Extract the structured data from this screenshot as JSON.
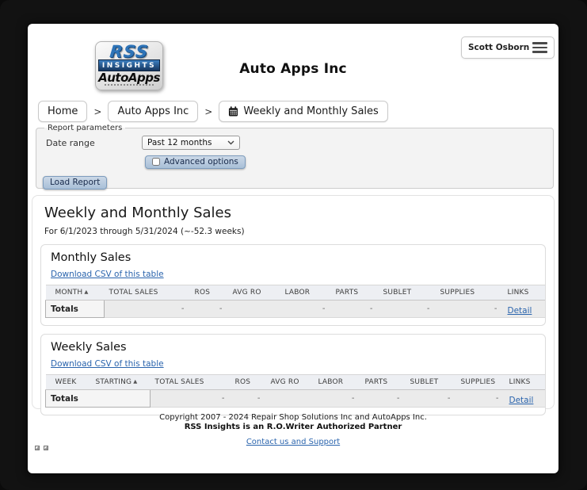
{
  "colors": {
    "page_bg": "#0b0b0b",
    "link": "#2a64ad",
    "button_bg": "#aec3da",
    "table_header_bg": "#edeff3",
    "logo_blue": "#2e74b8"
  },
  "user_menu": {
    "label": "Scott Osborn"
  },
  "header": {
    "title": "Auto Apps Inc",
    "logo": {
      "rss": "RSS",
      "insights": "INSIGHTS",
      "autoapps": "AutoApps"
    }
  },
  "breadcrumb": {
    "separator": ">",
    "items": [
      {
        "label": "Home"
      },
      {
        "label": "Auto Apps Inc"
      },
      {
        "label": "Weekly and Monthly Sales",
        "icon": "calendar-icon"
      }
    ]
  },
  "report_parameters": {
    "legend": "Report parameters",
    "date_range_label": "Date range",
    "date_range_value": "Past 12 months",
    "advanced_options_label": "Advanced options",
    "advanced_options_checked": false,
    "load_report_label": "Load Report"
  },
  "report": {
    "title": "Weekly and Monthly Sales",
    "subtitle": "For 6/1/2023 through 5/31/2024 (~-52.3 weeks)",
    "tables": [
      {
        "title": "Monthly Sales",
        "csv_link_label": "Download CSV of this table",
        "columns": [
          {
            "label": "MONTH",
            "sort": "asc"
          },
          {
            "label": "TOTAL SALES"
          },
          {
            "label": "ROS"
          },
          {
            "label": "AVG RO"
          },
          {
            "label": "LABOR"
          },
          {
            "label": "PARTS"
          },
          {
            "label": "SUBLET"
          },
          {
            "label": "SUPPLIES"
          },
          {
            "label": "LINKS"
          }
        ],
        "totals": {
          "label": "Totals",
          "label_colspan": 1,
          "values": [
            "-",
            "-",
            "",
            "-",
            "-",
            "-",
            "-"
          ],
          "detail_link_label": "Detail"
        }
      },
      {
        "title": "Weekly Sales",
        "csv_link_label": "Download CSV of this table",
        "columns": [
          {
            "label": "WEEK"
          },
          {
            "label": "STARTING",
            "sort": "asc"
          },
          {
            "label": "TOTAL SALES"
          },
          {
            "label": "ROS"
          },
          {
            "label": "AVG RO"
          },
          {
            "label": "LABOR"
          },
          {
            "label": "PARTS"
          },
          {
            "label": "SUBLET"
          },
          {
            "label": "SUPPLIES"
          },
          {
            "label": "LINKS"
          }
        ],
        "totals": {
          "label": "Totals",
          "label_colspan": 2,
          "values": [
            "-",
            "-",
            "",
            "-",
            "-",
            "-",
            "-"
          ],
          "detail_link_label": "Detail"
        }
      }
    ]
  },
  "footer": {
    "line1": "Copyright 2007 - 2024 Repair Shop Solutions Inc and AutoApps Inc.",
    "line2": "RSS Insights is an R.O.Writer Authorized Partner",
    "link_label": "Contact us and Support"
  }
}
